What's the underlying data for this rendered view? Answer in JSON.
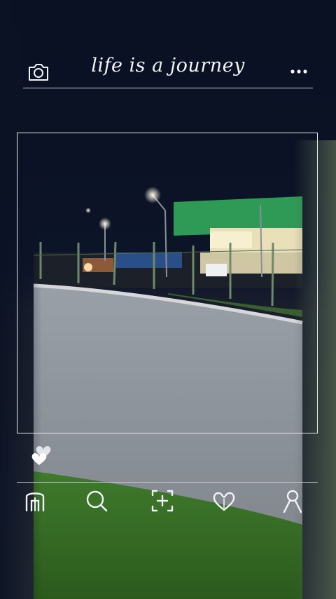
{
  "header": {
    "title": "life is a journey",
    "left_icon": "camera-icon",
    "right_icon": "more-dots-icon"
  },
  "photo": {
    "description_icon": "night-parking-lot-photo"
  },
  "actions": {
    "like_icon": "hearts-icon"
  },
  "bottom_nav": {
    "items": [
      {
        "icon": "home-icon"
      },
      {
        "icon": "search-icon"
      },
      {
        "icon": "add-post-icon"
      },
      {
        "icon": "heart-icon"
      },
      {
        "icon": "profile-icon"
      }
    ]
  },
  "colors": {
    "background": "#0b1224",
    "line": "#c8ccd4",
    "icon": "#f2f4f8",
    "warehouse_green": "#2f9a55"
  }
}
